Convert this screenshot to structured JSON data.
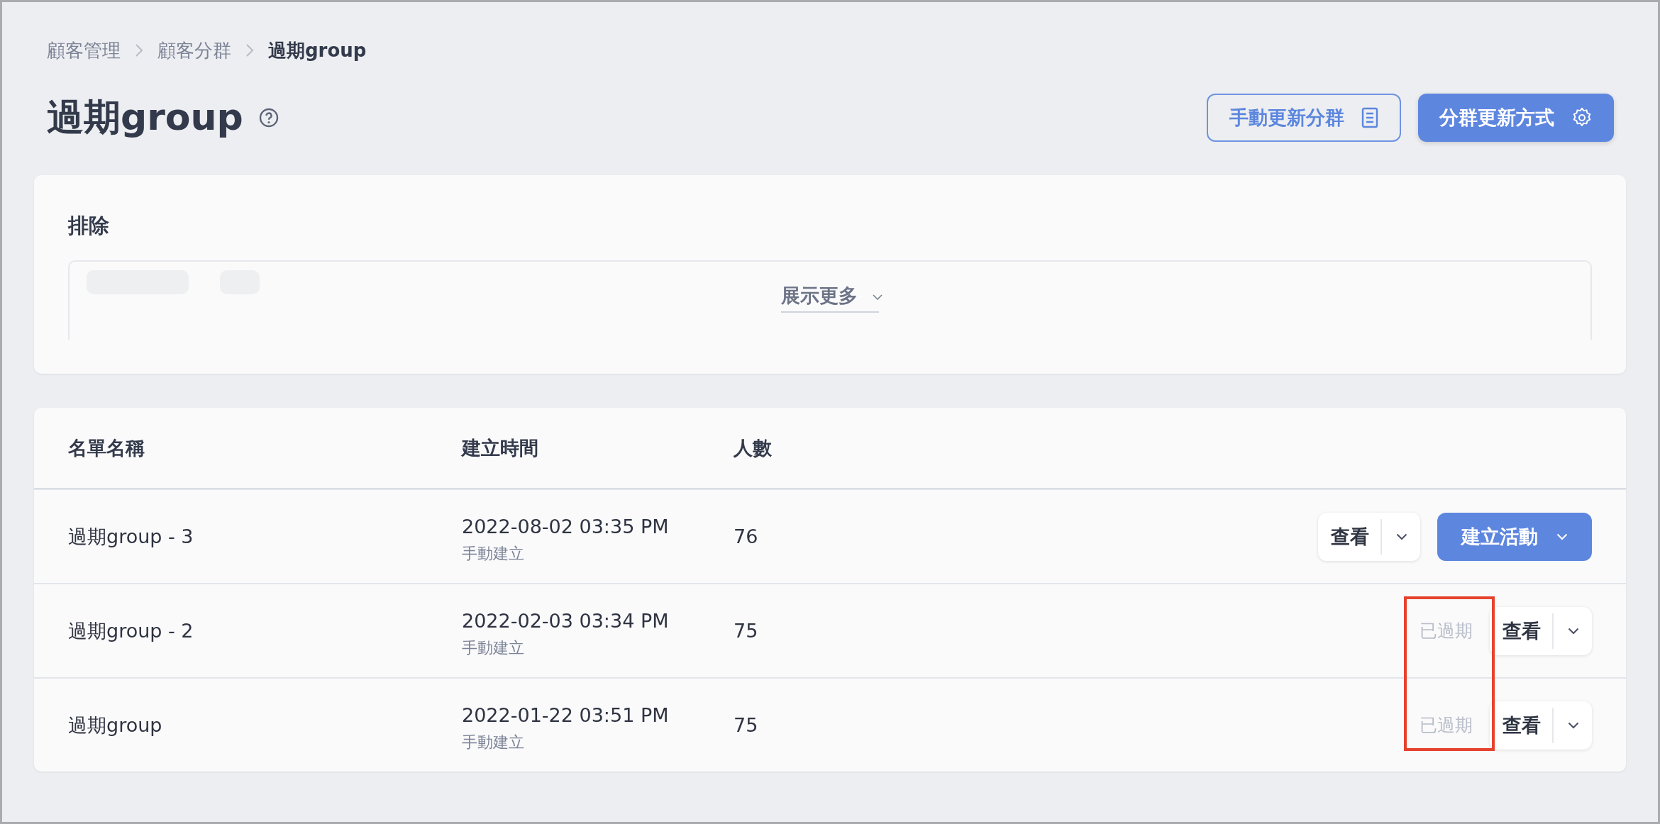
{
  "breadcrumb": [
    {
      "label": "顧客管理",
      "current": false
    },
    {
      "label": "顧客分群",
      "current": false
    },
    {
      "label": "過期group",
      "current": true
    }
  ],
  "title": "過期group",
  "header_buttons": [
    {
      "label": "手動更新分群",
      "kind": "outline"
    },
    {
      "label": "分群更新方式",
      "kind": "primary"
    }
  ],
  "exclude": {
    "title": "排除",
    "faded_tags": [
      {
        "kind": "wide"
      },
      {
        "kind": "narrow"
      }
    ],
    "show_more": "展示更多"
  },
  "table": {
    "columns": [
      "名單名稱",
      "建立時間",
      "人數"
    ],
    "rows": [
      {
        "name": "過期group - 3",
        "created": "2022-08-02 03:35 PM",
        "source": "手動建立",
        "count": "76",
        "view": "查看",
        "create": "建立活動"
      },
      {
        "name": "過期group - 2",
        "created": "2022-02-03 03:34 PM",
        "source": "手動建立",
        "count": "75",
        "status": "已過期",
        "view": "查看"
      },
      {
        "name": "過期group",
        "created": "2022-01-22 03:51 PM",
        "source": "手動建立",
        "count": "75",
        "status": "已過期",
        "view": "查看"
      }
    ]
  },
  "annotation": {
    "color": "#e5432d"
  }
}
